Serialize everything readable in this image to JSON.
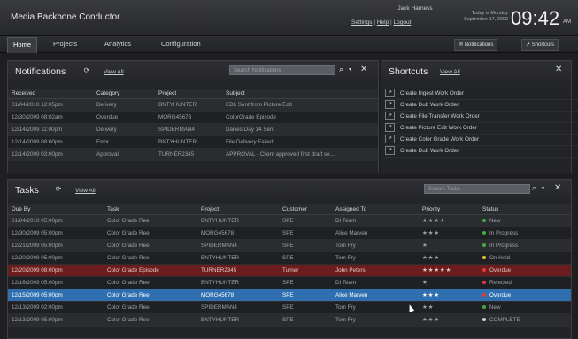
{
  "app": {
    "title": "Media Backbone Conductor"
  },
  "topbar": {
    "links": [
      "Settings",
      "Help",
      "Logout"
    ],
    "user_name": "Jack Harness",
    "user_sub": "Jack Harness",
    "date_line1": "Today is Monday",
    "date_line2": "September 17, 2009",
    "time": "09:42",
    "ampm": "AM"
  },
  "nav": {
    "tabs": [
      "Home",
      "Projects",
      "Analytics",
      "Configuration"
    ],
    "notifications_btn": "Notifications",
    "shortcuts_btn": "Shortcuts"
  },
  "notifications": {
    "title": "Notifications",
    "view_all": "View All",
    "search_placeholder": "Search Notifications",
    "columns": [
      "Received",
      "Category",
      "Project",
      "Subject"
    ],
    "rows": [
      [
        "01/04/2010 12:05pm",
        "Delivery",
        "BNTYHUNTER",
        "EDL Sent from Picture Edit"
      ],
      [
        "12/30/2009 08:02am",
        "Overdue",
        "MORG45678",
        "ColorGrade Episode"
      ],
      [
        "12/14/2009 11:00pm",
        "Delivery",
        "SPIDERMAN4",
        "Dailies Day 14 Sent"
      ],
      [
        "12/14/2009 08:00pm",
        "Error",
        "BNTYHUNTER",
        "File Delivery Failed"
      ],
      [
        "12/14/2009 03:00pm",
        "Approval",
        "TURNER2345",
        "APPROVAL - Client approved first draft se..."
      ]
    ]
  },
  "shortcuts": {
    "title": "Shortcuts",
    "view_all": "View All",
    "items": [
      "Create Ingest Work Order",
      "Create Dub Work Order",
      "Create File Transfer Work Order",
      "Create Picture Edit Work Order",
      "Create Color Grade Work Order",
      "Create Dub Work Order"
    ]
  },
  "tasks": {
    "title": "Tasks",
    "view_all": "View All",
    "search_placeholder": "Search Tasks",
    "columns": [
      "Due By",
      "Task",
      "Project",
      "Customer",
      "Assigned To",
      "Priority",
      "Status"
    ],
    "rows": [
      {
        "due": "01/04/2010 05:00pm",
        "task": "Color Grade Reel",
        "project": "BNTYHUNTER",
        "customer": "SPE",
        "assigned": "DI Team",
        "priority": "★★★★",
        "status": "New",
        "status_color": "#3fae3f"
      },
      {
        "due": "12/30/2009 05:00pm",
        "task": "Color Grade Reel",
        "project": "MORG45678",
        "customer": "SPE",
        "assigned": "Alice Marven",
        "priority": "★★★",
        "status": "In Progress",
        "status_color": "#3fae3f"
      },
      {
        "due": "12/21/2009 05:00pm",
        "task": "Color Grade Reel",
        "project": "SPIDERMAN4",
        "customer": "SPE",
        "assigned": "Tom Fry",
        "priority": "★",
        "status": "In Progress",
        "status_color": "#3fae3f"
      },
      {
        "due": "12/20/2009 05:00pm",
        "task": "Color Grade Reel",
        "project": "BNTYHUNTER",
        "customer": "SPE",
        "assigned": "Tom Fry",
        "priority": "★★★",
        "status": "On Hold",
        "status_color": "#e6c12e"
      },
      {
        "due": "12/20/2009 08:00pm",
        "task": "Color Grade Episode",
        "project": "TURNER2345",
        "customer": "Turner",
        "assigned": "John Peters",
        "priority": "★★★★★",
        "status": "Overdue",
        "status_color": "#e03a3a"
      },
      {
        "due": "12/16/2009 05:00pm",
        "task": "Color Grade Reel",
        "project": "BNTYHUNTER",
        "customer": "SPE",
        "assigned": "DI Team",
        "priority": "★",
        "status": "Rejected",
        "status_color": "#e03a3a"
      },
      {
        "due": "12/15/2009 05:00pm",
        "task": "Color Grade Reel",
        "project": "MORG45678",
        "customer": "SPE",
        "assigned": "Alice Marven",
        "priority": "★★★",
        "status": "Overdue",
        "status_color": "#e03a3a"
      },
      {
        "due": "12/13/2009 02:00pm",
        "task": "Color Grade Reel",
        "project": "SPIDERMAN4",
        "customer": "SPE",
        "assigned": "Tom Fry",
        "priority": "★★",
        "status": "New",
        "status_color": "#3fae3f"
      },
      {
        "due": "12/13/2009 05:00pm",
        "task": "Color Grade Reel",
        "project": "BNTYHUNTER",
        "customer": "SPE",
        "assigned": "Tom Fry",
        "priority": "★★★",
        "status": "COMPLETE",
        "status_color": "#cfd2d6"
      }
    ]
  }
}
